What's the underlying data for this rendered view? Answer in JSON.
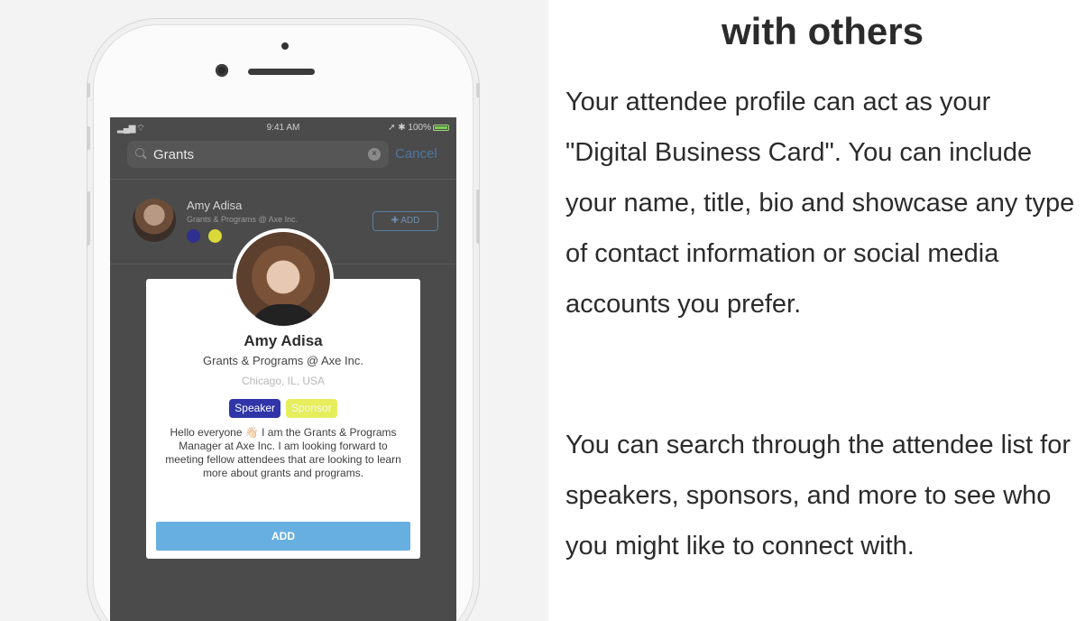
{
  "heading": "with others",
  "paragraphs": [
    {
      "text": "Your attendee profile can act as your \"Digital Business Card\". You can include your name, title, bio and showcase any type of contact information or social media accounts you prefer."
    },
    {
      "text": "You can search through the attendee list for speakers, sponsors, and more to see who you might like to connect with."
    }
  ],
  "phone": {
    "status_bar": {
      "time": "9:41 AM",
      "battery_pct": "100%"
    },
    "search": {
      "query": "Grants",
      "cancel_label": "Cancel"
    },
    "result": {
      "name": "Amy Adisa",
      "subtitle": "Grants & Programs @ Axe Inc.",
      "add_label": "ADD",
      "dot_colors": [
        "#2e2f8f",
        "#d9d93a"
      ]
    },
    "modal": {
      "name": "Amy Adisa",
      "title": "Grants & Programs @ Axe Inc.",
      "location": "Chicago, IL, USA",
      "tags": [
        {
          "label": "Speaker",
          "bg": "#2f35a8",
          "fg": "#ffffff"
        },
        {
          "label": "Sponsor",
          "bg": "#e6ee5c",
          "fg": "#f5f5f5"
        }
      ],
      "bio": "Hello everyone 👋🏻 I am the Grants & Programs Manager at Axe Inc. I am looking forward to meeting fellow attendees that are looking to learn more about grants and programs.",
      "add_button": "ADD"
    }
  },
  "colors": {
    "accent": "#67afe0",
    "text": "#2b2b2b"
  }
}
